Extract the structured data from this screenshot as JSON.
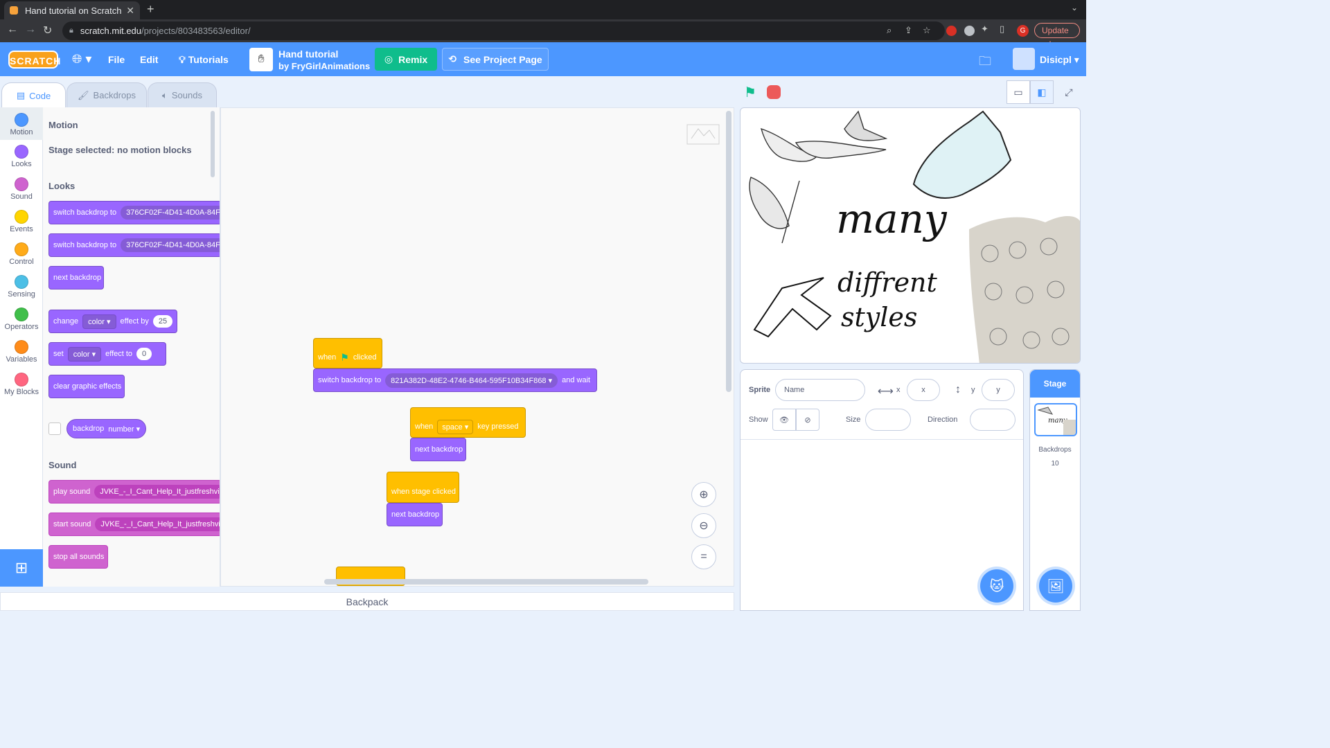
{
  "browser": {
    "tab_title": "Hand tutorial on Scratch",
    "url_host": "scratch.mit.edu",
    "url_path": "/projects/803483563/editor/",
    "update_label": "Update",
    "profile_initial": "G"
  },
  "menubar": {
    "logo": "SCRATCH",
    "file": "File",
    "edit": "Edit",
    "tutorials": "Tutorials",
    "project_title": "Hand tutorial",
    "project_author": "by FryGirlAnimations",
    "remix": "Remix",
    "see_project_page": "See Project Page",
    "username": "Disicpl"
  },
  "editor_tabs": [
    "Code",
    "Backdrops",
    "Sounds"
  ],
  "categories": [
    {
      "label": "Motion",
      "color": "#4c97ff"
    },
    {
      "label": "Looks",
      "color": "#9966ff"
    },
    {
      "label": "Sound",
      "color": "#cf63cf"
    },
    {
      "label": "Events",
      "color": "#ffd500"
    },
    {
      "label": "Control",
      "color": "#ffab19"
    },
    {
      "label": "Sensing",
      "color": "#4cbfe6"
    },
    {
      "label": "Operators",
      "color": "#40bf4a"
    },
    {
      "label": "Variables",
      "color": "#ff8c1a"
    },
    {
      "label": "My Blocks",
      "color": "#ff6680"
    }
  ],
  "palette": {
    "motion_header": "Motion",
    "motion_note": "Stage selected: no motion blocks",
    "looks_header": "Looks",
    "switch_backdrop": "switch backdrop to",
    "backdrop_value": "376CF02F-4D41-4D0A-84F",
    "next_backdrop": "next backdrop",
    "change": "change",
    "effect_by": "effect by",
    "change_value": "25",
    "set": "set",
    "effect_to": "effect to",
    "set_value": "0",
    "color": "color",
    "clear_effects": "clear graphic effects",
    "backdrop": "backdrop",
    "number": "number",
    "sound_header": "Sound",
    "play_sound": "play sound",
    "start_sound": "start sound",
    "sound_value": "JVKE_-_I_Cant_Help_It_justfreshvi",
    "stop_all": "stop all sounds"
  },
  "scripts": {
    "when": "when",
    "clicked": "clicked",
    "switch_backdrop": "switch backdrop to",
    "backdrop_value": "821A382D-48E2-4746-B464-595F10B34F868",
    "and_wait": "and wait",
    "key_when": "when",
    "key_value": "space",
    "key_pressed": "key pressed",
    "next_backdrop": "next backdrop",
    "when_stage_clicked": "when stage clicked",
    "next_backdrop_2": "next backdrop"
  },
  "stage_art": {
    "line1": "many",
    "line2": "diffrent",
    "line3": "styles"
  },
  "sprite_info": {
    "sprite": "Sprite",
    "name_placeholder": "Name",
    "x": "x",
    "y": "y",
    "show": "Show",
    "size": "Size",
    "direction": "Direction"
  },
  "stage_panel": {
    "header": "Stage",
    "backdrops_label": "Backdrops",
    "backdrops_count": "10"
  },
  "backpack": "Backpack"
}
